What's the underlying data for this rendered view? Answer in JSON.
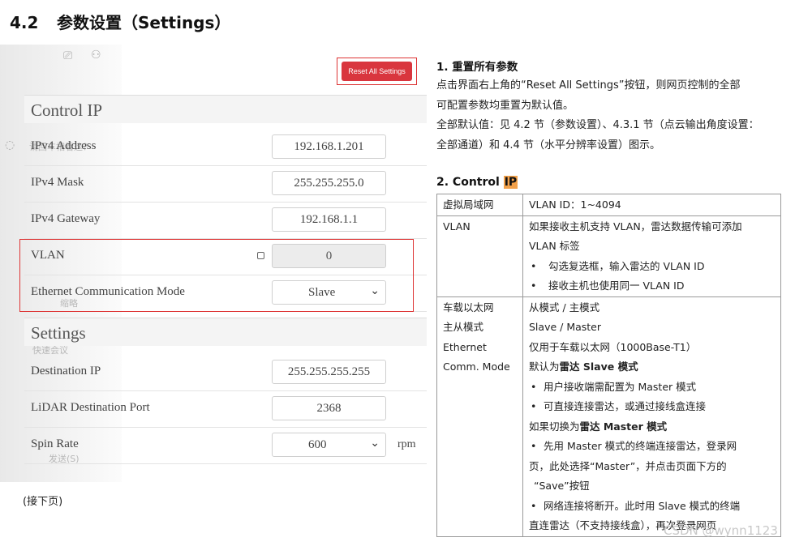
{
  "section": {
    "number": "4.2",
    "title": "参数设置（Settings）"
  },
  "left_ui": {
    "ghost": {
      "texts": [
        "请回车相看这？",
        "缩略",
        "快速会议",
        "发送(S)"
      ],
      "icons": [
        "video-icon",
        "add-user-icon",
        "circle-check-icon"
      ]
    },
    "reset_button": "Reset All Settings",
    "groups": {
      "control_ip": "Control IP",
      "settings": "Settings"
    },
    "rows": {
      "ipv4_address": {
        "label": "IPv4 Address",
        "value": "192.168.1.201"
      },
      "ipv4_mask": {
        "label": "IPv4 Mask",
        "value": "255.255.255.0"
      },
      "ipv4_gateway": {
        "label": "IPv4 Gateway",
        "value": "192.168.1.1"
      },
      "vlan": {
        "label": "VLAN",
        "value": "0",
        "checked": false
      },
      "eth_mode": {
        "label": "Ethernet Communication Mode",
        "value": "Slave"
      },
      "dest_ip": {
        "label": "Destination IP",
        "value": "255.255.255.255"
      },
      "dest_port": {
        "label": "LiDAR Destination Port",
        "value": "2368"
      },
      "spin_rate": {
        "label": "Spin Rate",
        "value": "600",
        "unit": "rpm"
      }
    }
  },
  "continued": "(接下页)",
  "right": {
    "heading1": "1.  重置所有参数",
    "para": [
      "点击界面右上角的“Reset All Settings”按钮，则网页控制的全部",
      "可配置参数均重置为默认值。",
      "全部默认值：见 4.2 节（参数设置）、4.3.1 节（点云输出角度设置：",
      "全部通道）和 4.4 节（水平分辨率设置）图示。"
    ],
    "heading2_prefix": "2. Control ",
    "heading2_highlight": "IP",
    "table": {
      "r1": {
        "c1": "虚拟局域网",
        "c2": "VLAN ID：1~4094"
      },
      "r2": {
        "c1": "VLAN",
        "c2a": "如果接收主机支持 VLAN，雷达数据传输可添加",
        "c2b": "VLAN 标签",
        "b1": "勾选复选框，输入雷达的 VLAN ID",
        "b2": "接收主机也使用同一 VLAN ID"
      },
      "r3": {
        "c1a": "车载以太网",
        "c1b": "主从模式",
        "c1c": "Ethernet",
        "c1d": "Comm. Mode",
        "l1": "从模式  /  主模式",
        "l2": "Slave / Master",
        "l3": "仅用于车载以太网（1000Base-T1）",
        "l4_pre": "默认为",
        "l4_bold": "雷达 Slave 模式",
        "b1": "用户接收端需配置为 Master 模式",
        "b2": "可直接连接雷达，或通过接线盒连接",
        "l5_pre": "如果切换为",
        "l5_bold": "雷达 Master 模式",
        "b3a": "先用 Master 模式的终端连接雷达，登录网",
        "b3b": "页，此处选择“Master”，并点击页面下方的",
        "b3c": "“Save”按钮",
        "b4a": "网络连接将断开。此时用 Slave 模式的终端",
        "b4b": "直连雷达（不支持接线盒），再次登录网页"
      }
    }
  },
  "watermark": "CSDN @wynn1123",
  "colors": {
    "accent_red": "#d9363e",
    "highlight": "#f3a14a"
  }
}
